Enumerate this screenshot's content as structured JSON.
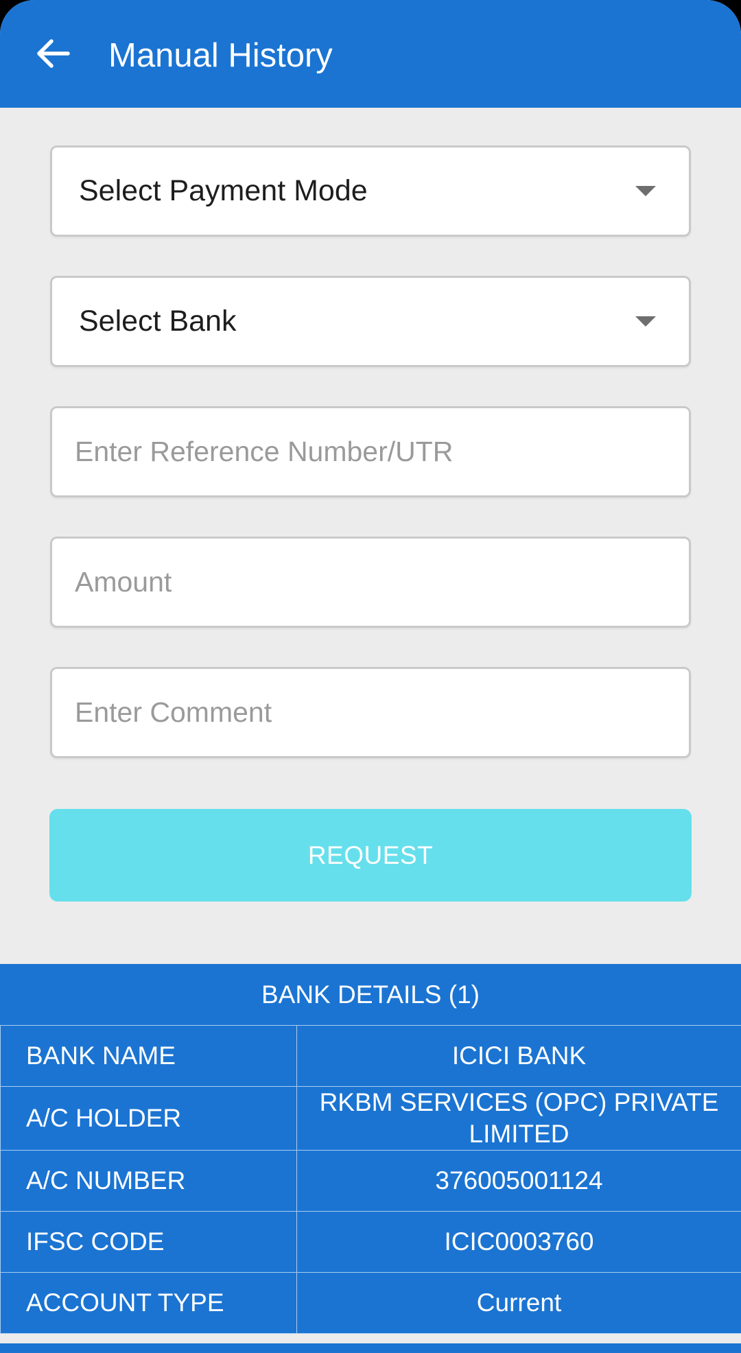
{
  "app_bar": {
    "title": "Manual History",
    "back_icon": "arrow-left-icon",
    "color": "#1b74d2"
  },
  "form": {
    "payment_mode": {
      "label": "Select Payment Mode",
      "icon": "caret-down-icon"
    },
    "bank": {
      "label": "Select Bank",
      "icon": "caret-down-icon"
    },
    "reference": {
      "value": "",
      "placeholder": "Enter Reference Number/UTR"
    },
    "amount": {
      "value": "",
      "placeholder": "Amount"
    },
    "comment": {
      "value": "",
      "placeholder": "Enter Comment"
    },
    "request_button": {
      "label": "REQUEST",
      "color": "#66dfec"
    }
  },
  "bank_details": {
    "header": "BANK DETAILS (1)",
    "rows": [
      {
        "key": "BANK NAME",
        "value": "ICICI BANK"
      },
      {
        "key": "A/C HOLDER",
        "value": "RKBM SERVICES (OPC) PRIVATE LIMITED"
      },
      {
        "key": "A/C NUMBER",
        "value": "376005001124"
      },
      {
        "key": "IFSC CODE",
        "value": "ICIC0003760"
      },
      {
        "key": "ACCOUNT TYPE",
        "value": "Current"
      }
    ]
  }
}
